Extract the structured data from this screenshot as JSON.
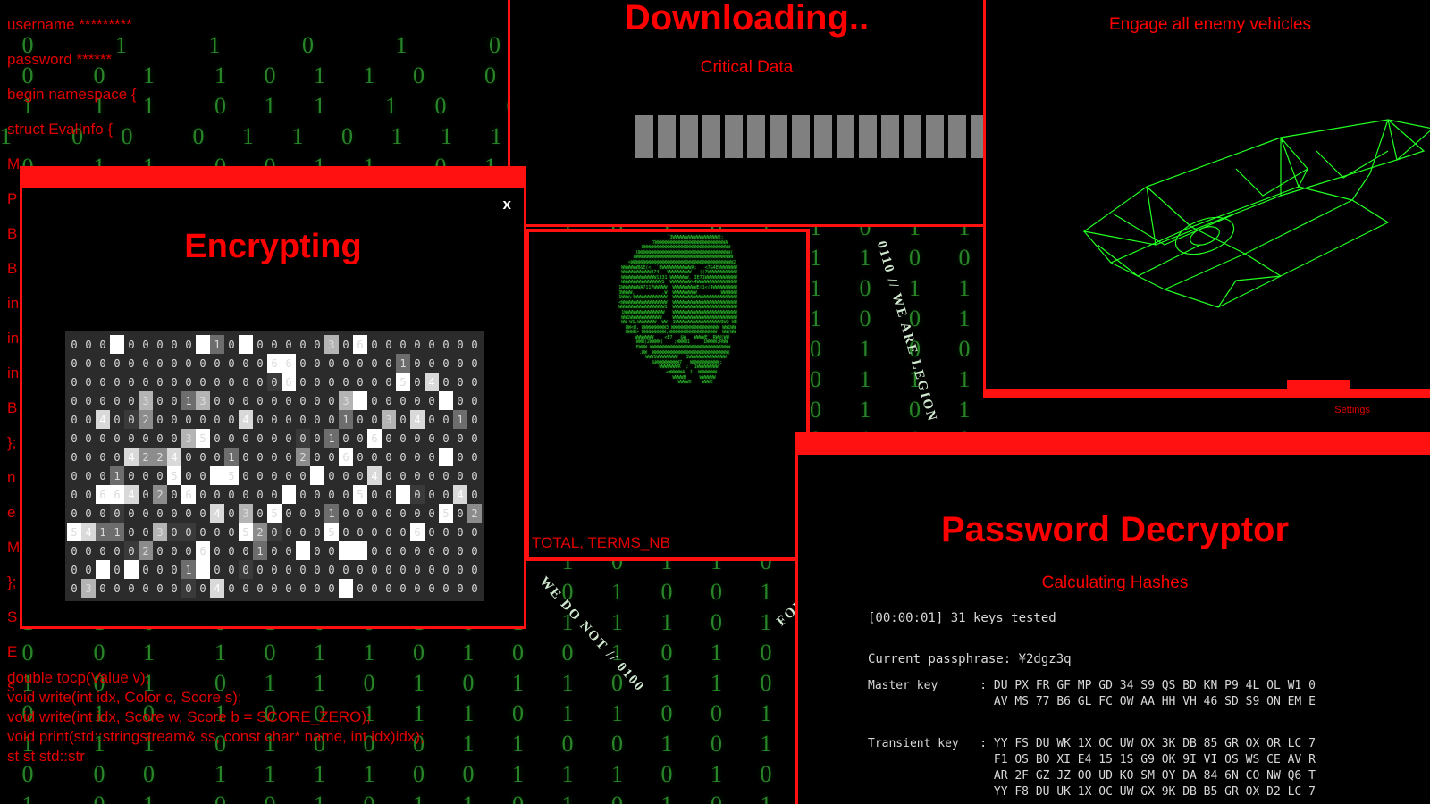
{
  "theme": {
    "accent": "#ff1111",
    "red_text": "#e20000",
    "matrix_green": "#2f9e2f",
    "terminal_text": "#d8d8d8"
  },
  "code_panel": {
    "lines": [
      "username *********",
      "password ******",
      "begin namespace {",
      "struct EvalInfo {",
      "M",
      "P",
      "B",
      "B",
      "in",
      "in",
      "in",
      "B",
      "};",
      "n",
      "e",
      "M",
      "};",
      "S",
      "E",
      "s"
    ],
    "bottom_lines": [
      "double tocp(Value v);",
      "void write(int idx, Color c, Score s);",
      "void write(int idx, Score w, Score b = SCORE_ZERO);",
      "void print(std::stringstream& ss, const char* name, int idx)idx);",
      "st st std::str"
    ]
  },
  "downloading_window": {
    "title": "Downloading..",
    "subtitle": "Critical Data",
    "progress_blocks": 18,
    "block_color": "#808080"
  },
  "ship_window": {
    "title": "Engage all enemy vehicles",
    "settings_label": "Settings",
    "wireframe_color": "#22ff22"
  },
  "encrypting_window": {
    "title": "Encrypting",
    "close_label": "x",
    "grid": {
      "columns": 29,
      "rows": 14,
      "values": [
        [
          0,
          0,
          0,
          0,
          0,
          0,
          0,
          0,
          0,
          0,
          1,
          0,
          0,
          0,
          0,
          0,
          0,
          0,
          3,
          0,
          6,
          0,
          0,
          0,
          0,
          0,
          0,
          0,
          0
        ],
        [
          0,
          0,
          0,
          0,
          0,
          0,
          0,
          0,
          0,
          0,
          0,
          0,
          0,
          0,
          6,
          6,
          0,
          0,
          0,
          0,
          0,
          0,
          0,
          1,
          0,
          0,
          0,
          0,
          0
        ],
        [
          0,
          0,
          0,
          0,
          0,
          0,
          0,
          0,
          0,
          0,
          0,
          0,
          0,
          0,
          0,
          6,
          0,
          0,
          0,
          0,
          0,
          0,
          0,
          5,
          0,
          4,
          0,
          0,
          0
        ],
        [
          0,
          0,
          0,
          0,
          0,
          3,
          0,
          0,
          1,
          3,
          0,
          0,
          0,
          0,
          0,
          0,
          0,
          0,
          0,
          3,
          0,
          0,
          0,
          0,
          0,
          0,
          0,
          0,
          0
        ],
        [
          0,
          0,
          4,
          0,
          0,
          2,
          0,
          0,
          0,
          0,
          0,
          0,
          4,
          0,
          0,
          0,
          0,
          0,
          0,
          1,
          0,
          0,
          3,
          0,
          4,
          0,
          0,
          1,
          0
        ],
        [
          0,
          0,
          0,
          0,
          0,
          0,
          0,
          0,
          3,
          5,
          0,
          0,
          0,
          0,
          0,
          0,
          0,
          0,
          1,
          0,
          0,
          6,
          0,
          0,
          0,
          0,
          0,
          0,
          0
        ],
        [
          0,
          0,
          0,
          0,
          4,
          2,
          2,
          4,
          0,
          0,
          0,
          1,
          0,
          0,
          0,
          0,
          2,
          0,
          0,
          6,
          0,
          0,
          0,
          0,
          0,
          0,
          0,
          0,
          0
        ],
        [
          0,
          0,
          0,
          1,
          0,
          0,
          0,
          5,
          0,
          0,
          0,
          5,
          0,
          0,
          0,
          0,
          0,
          0,
          0,
          0,
          0,
          4,
          0,
          0,
          0,
          0,
          0,
          0,
          0
        ],
        [
          0,
          0,
          6,
          6,
          4,
          0,
          2,
          0,
          6,
          0,
          0,
          0,
          0,
          0,
          0,
          0,
          0,
          0,
          0,
          0,
          5,
          0,
          0,
          0,
          0,
          0,
          0,
          4,
          0
        ],
        [
          0,
          0,
          0,
          0,
          0,
          0,
          0,
          0,
          0,
          0,
          4,
          0,
          3,
          0,
          5,
          0,
          0,
          0,
          1,
          0,
          0,
          0,
          0,
          0,
          0,
          0,
          5,
          0,
          2
        ],
        [
          5,
          4,
          1,
          1,
          0,
          0,
          3,
          0,
          0,
          0,
          0,
          0,
          5,
          2,
          0,
          0,
          0,
          0,
          5,
          0,
          0,
          0,
          0,
          0,
          6,
          0,
          0,
          0,
          0
        ],
        [
          0,
          0,
          0,
          0,
          0,
          2,
          0,
          0,
          0,
          6,
          0,
          0,
          0,
          1,
          0,
          0,
          0,
          0,
          0,
          0,
          0,
          0,
          0,
          0,
          0,
          0,
          0,
          0,
          0
        ],
        [
          0,
          0,
          0,
          0,
          0,
          0,
          0,
          0,
          1,
          0,
          0,
          0,
          0,
          0,
          0,
          0,
          0,
          0,
          0,
          0,
          0,
          0,
          0,
          0,
          0,
          0,
          0,
          0,
          0
        ],
        [
          0,
          3,
          0,
          0,
          0,
          0,
          0,
          0,
          0,
          0,
          4,
          0,
          0,
          0,
          0,
          0,
          0,
          0,
          0,
          0,
          0,
          0,
          0,
          0,
          0,
          0,
          0,
          0,
          0
        ]
      ]
    }
  },
  "anon_window": {
    "overlap_text": "TOTAL, TERMS_NB",
    "ring_text_left": "WE DO NOT // 0100",
    "ring_text_right": "0110 // WE ARE LEGION",
    "ring_text_forgive": "FORGIVE",
    "ascii_art": "                  `3WWWWWWWWWWWWWWWWW2;\n              7WWWWWWWWWWWWWWWWWWWWWWWWWWA\n           WWWWWWWWWWWWWWWWWWWWWWWWWWWWWWWWW\n          UWWWWWWWWWWWWWWWWWWWWWWWWWWWWWWWWWW(\n         WWWWWWWWWWWWWWWWWWWWWWWWWWWWWWWWWWWWW\n        <WWWWWWWWWWWWWWWWWWWWWWWWWWWWWWWWWWWWWW2\n      WWWWWWB&E(<  `BWWWWWWWWWWWA;   <7&4EWWWWWWW\n      WWWWWWWWWWW874`  WWWWWWWWW   ((7WWWWWWWWWWW\n      WWWWWWWWWWWWW1331 WWWWWWW. IE71WWWWWWWWWWWW\n      WWWWWWWWWWWWWWW1  WWWWWWWW<4WWWWWWWWWWWWWWW\n     1WWWWWWWA7117WWWWW  WWWWWWWWWE(1<(4WWWWWWWWW\n     3WWWW,          .W  WWWWWWWWW         WWWWWW\n     1WWW;4WWWWWWWWWWWW  WWWWWWWWWWWWWWWWWWWWWWWW\n     <WWWWWWWWWWWWWWWWW  WWWWWWWWWWWWWWWWWWWWWWWW\n     WWWWWWWWWWWWWWWWW1  WWWWWWWWWWWWWWWWWWWWWWWW\n      1WWWWWWWWWWWWWWW   WWWWWWWWWWWWWWWWWWWWWWWW\n      WW1WWWWWWWWWWWW    WWWWWWWWWWWWWWWWWWWWWWWW\n      WW W1,WWWWWWW  WW  1WWWWWWWWWWWWWWWWW3W2 WB\n       WW<W, WWWWWWWWW3 WWWWWWWWWWWWWWWWWW WW1WW\n       WWWB> WWWWWWWWW;WWWWWWWWWWWWWWWWWW  WW(WW\n        WWWWWWW    <E7   &W   WWWWE` RWW(WW\n        WWW(2WWWW(    ;WWWW1     1WWWW;RWW\n         EWWW WWWWWWWWWWWWWWWWWWWWWWWWWWRWWW\n          .WW  WWWWWWWWWWWWWWWWWWWWWWWWWWWW(\n           WWW1WWWWWWWW   1WWWWWWWWWWWWWW\n            &WWWWWWWWW7   WWWWWWWWWWW;\n              WWWWWWWR  ;  1WWWWWWWW`\n               <WWWWW4  1 .WWWWWWW\n                 WWWWB     WWWWWW\n                  WWWWX    WWWE"
  },
  "password_window": {
    "title": "Password Decryptor",
    "subtitle": "Calculating Hashes",
    "status_line": "[00:00:01] 31 keys tested",
    "passphrase_line": "Current passphrase: ¥2dgz3q",
    "master_key_label": "Master key",
    "master_key_rows": [
      "DU PX FR GF MP GD 34 S9 QS BD KN P9 4L OL W1 0",
      "AV MS 77 B6 GL FC OW AA HH VH 46 SD S9 ON EM E"
    ],
    "transient_key_label": "Transient key",
    "transient_key_rows": [
      "YY FS DU WK 1X OC UW OX 3K DB 85 GR OX OR LC 7",
      "F1 OS BO XI E4 15 1S G9 OK 9I VI OS WS CE AV R",
      "AR 2F GZ JZ OO UD KO SM OY DA 84 6N CO NW Q6 T",
      "YY F8 DU UK 1X OC UW GX 9K DB B5 GR OX D2 LC 7"
    ]
  }
}
